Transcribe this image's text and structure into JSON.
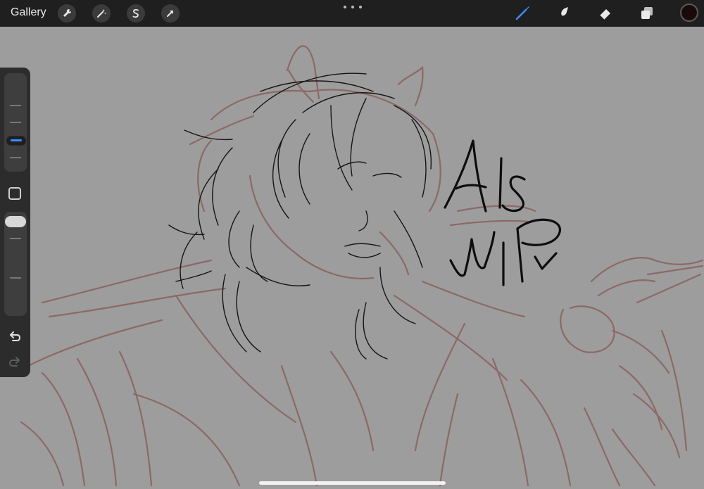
{
  "topbar": {
    "gallery_label": "Gallery",
    "actions": [
      "wrench-icon",
      "magic-wand-icon",
      "selection-icon",
      "transform-arrow-icon"
    ],
    "tools": [
      "brush-icon",
      "smudge-icon",
      "eraser-icon",
      "layers-icon"
    ],
    "active_tool": "brush-icon",
    "active_color": "#1a0a0a",
    "accent_color": "#3d8bff"
  },
  "sidebar": {
    "brush_size_level": 0.55,
    "brush_opacity_level": 1.0
  },
  "canvas": {
    "background_color": "#9d9d9d",
    "sketch_color": "#8a6461",
    "ink_color": "#111111"
  }
}
